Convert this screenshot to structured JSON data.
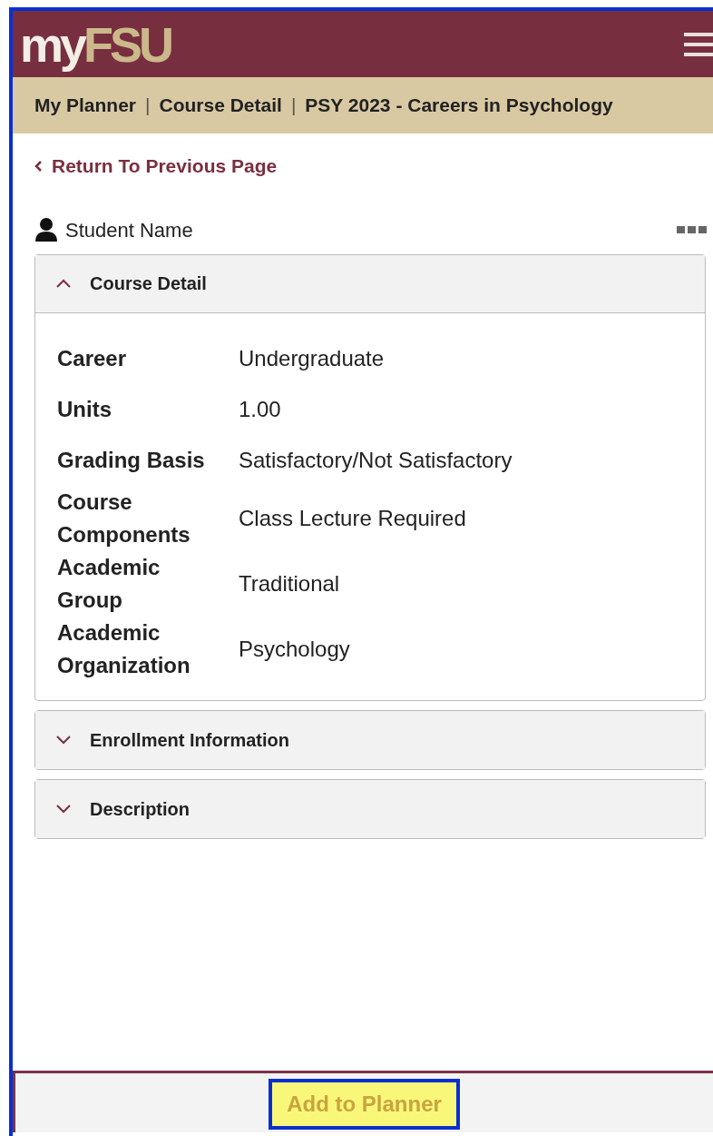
{
  "header": {
    "logo_prefix": "my",
    "logo_main": "FSU"
  },
  "breadcrumbs": [
    "My Planner",
    "Course Detail",
    "PSY 2023 - Careers in Psychology"
  ],
  "breadcrumb_separator": "|",
  "back_link": "Return To Previous Page",
  "student": {
    "name": "Student Name"
  },
  "sections": [
    {
      "title": "Course Detail",
      "expanded": true,
      "fields": [
        {
          "label": "Career",
          "value": "Undergraduate"
        },
        {
          "label": "Units",
          "value": "1.00"
        },
        {
          "label": "Grading Basis",
          "value": "Satisfactory/Not Satisfactory"
        },
        {
          "label": "Course Components",
          "value": "Class Lecture Required"
        },
        {
          "label": "Academic Group",
          "value": "Traditional"
        },
        {
          "label": "Academic Organization",
          "value": "Psychology"
        }
      ]
    },
    {
      "title": "Enrollment Information",
      "expanded": false
    },
    {
      "title": "Description",
      "expanded": false
    }
  ],
  "footer": {
    "button": "Add to Planner",
    "highlighted": true
  }
}
